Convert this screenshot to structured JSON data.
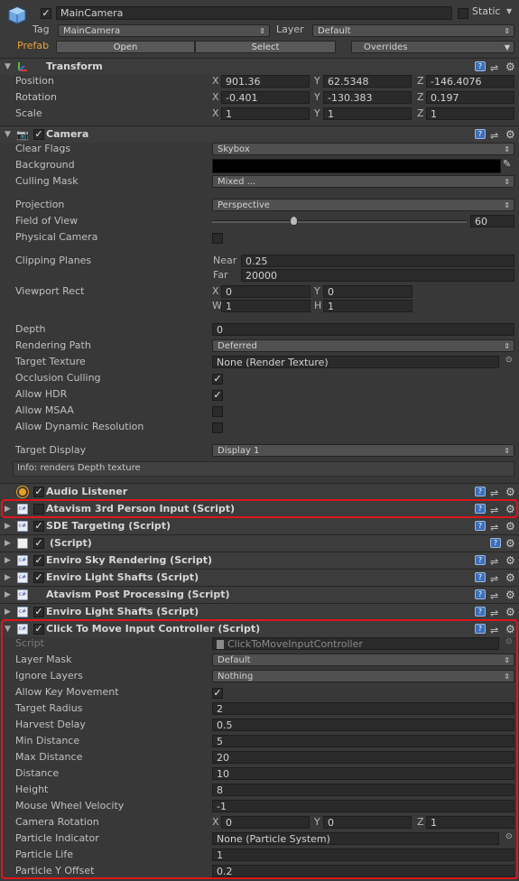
{
  "gameobject": {
    "enabled": true,
    "name": "MainCamera",
    "static_label": "Static",
    "static_checked": false,
    "tag_label": "Tag",
    "tag_value": "MainCamera",
    "layer_label": "Layer",
    "layer_value": "Default",
    "prefab_label": "Prefab",
    "open_label": "Open",
    "select_label": "Select",
    "overrides_label": "Overrides"
  },
  "transform": {
    "title": "Transform",
    "rows": [
      {
        "label": "Position",
        "x": "901.36",
        "y": "62.5348",
        "z": "-146.4076"
      },
      {
        "label": "Rotation",
        "x": "-0.401",
        "y": "-130.383",
        "z": "0.197"
      },
      {
        "label": "Scale",
        "x": "1",
        "y": "1",
        "z": "1"
      }
    ],
    "axes": {
      "x": "X",
      "y": "Y",
      "z": "Z"
    }
  },
  "camera": {
    "title": "Camera",
    "clear_flags_label": "Clear Flags",
    "clear_flags": "Skybox",
    "background_label": "Background",
    "background_color": "#000000",
    "culling_mask_label": "Culling Mask",
    "culling_mask": "Mixed ...",
    "projection_label": "Projection",
    "projection": "Perspective",
    "fov_label": "Field of View",
    "fov": "60",
    "fov_fraction": 0.32,
    "physical_camera_label": "Physical Camera",
    "clipping_planes_label": "Clipping Planes",
    "near_label": "Near",
    "near": "0.25",
    "far_label": "Far",
    "far": "20000",
    "viewport_label": "Viewport Rect",
    "vp_x_label": "X",
    "vp_x": "0",
    "vp_y_label": "Y",
    "vp_y": "0",
    "vp_w_label": "W",
    "vp_w": "1",
    "vp_h_label": "H",
    "vp_h": "1",
    "depth_label": "Depth",
    "depth": "0",
    "rendering_path_label": "Rendering Path",
    "rendering_path": "Deferred",
    "target_texture_label": "Target Texture",
    "target_texture": "None (Render Texture)",
    "occlusion_label": "Occlusion Culling",
    "hdr_label": "Allow HDR",
    "msaa_label": "Allow MSAA",
    "dynres_label": "Allow Dynamic Resolution",
    "target_display_label": "Target Display",
    "target_display": "Display 1",
    "info": "Info: renders Depth texture"
  },
  "components": [
    {
      "title": "Audio Listener"
    },
    {
      "title": "Atavism 3rd Person Input (Script)"
    },
    {
      "title": "SDE Targeting (Script)"
    },
    {
      "title": "(Script)"
    },
    {
      "title": "Enviro Sky Rendering (Script)"
    },
    {
      "title": "Enviro Light Shafts (Script)"
    },
    {
      "title": "Atavism Post Processing (Script)"
    },
    {
      "title": "Enviro Light Shafts (Script)"
    }
  ],
  "ctm": {
    "title": "Click To Move Input Controller (Script)",
    "icon_text": "c#",
    "script_label": "Script",
    "script_value": "ClickToMoveInputController",
    "layer_mask_label": "Layer Mask",
    "layer_mask": "Default",
    "ignore_layers_label": "Ignore Layers",
    "ignore_layers": "Nothing",
    "allow_key_label": "Allow Key Movement",
    "target_radius_label": "Target Radius",
    "target_radius": "2",
    "harvest_delay_label": "Harvest Delay",
    "harvest_delay": "0.5",
    "min_distance_label": "Min Distance",
    "min_distance": "5",
    "max_distance_label": "Max Distance",
    "max_distance": "20",
    "distance_label": "Distance",
    "distance": "10",
    "height_label": "Height",
    "height": "8",
    "mwv_label": "Mouse Wheel Velocity",
    "mwv": "-1",
    "cam_rot_label": "Camera Rotation",
    "cam_rot_x": "0",
    "cam_rot_y": "0",
    "cam_rot_z": "1",
    "particle_indicator_label": "Particle Indicator",
    "particle_indicator": "None (Particle System)",
    "particle_life_label": "Particle Life",
    "particle_life": "1",
    "particle_y_label": "Particle Y Offset",
    "particle_y": "0.2"
  },
  "colors": {
    "highlight": "#e0151b",
    "prefab": "#e8a23a",
    "script_icon": "#3056a0"
  }
}
